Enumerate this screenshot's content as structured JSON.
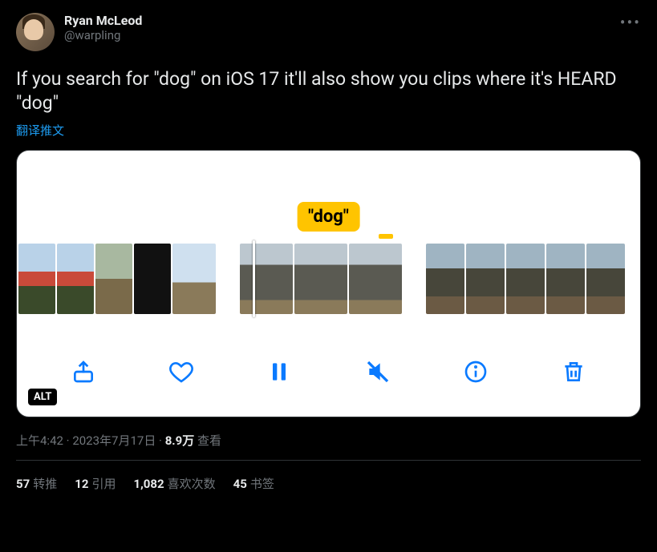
{
  "author": {
    "display_name": "Ryan McLeod",
    "handle": "@warpling"
  },
  "tweet_text": "If you search for \"dog\" on iOS 17 it'll also show you clips where it's HEARD \"dog\"",
  "translate_label": "翻译推文",
  "media": {
    "bubble_text": "\"dog\"",
    "alt_badge": "ALT"
  },
  "meta": {
    "time": "上午4:42",
    "dot": " · ",
    "date": "2023年7月17日",
    "views_count": "8.9万",
    "views_label": " 查看"
  },
  "stats": {
    "retweet_count": "57",
    "retweet_label": "转推",
    "quote_count": "12",
    "quote_label": "引用",
    "like_count": "1,082",
    "like_label": "喜欢次数",
    "bookmark_count": "45",
    "bookmark_label": "书签"
  }
}
